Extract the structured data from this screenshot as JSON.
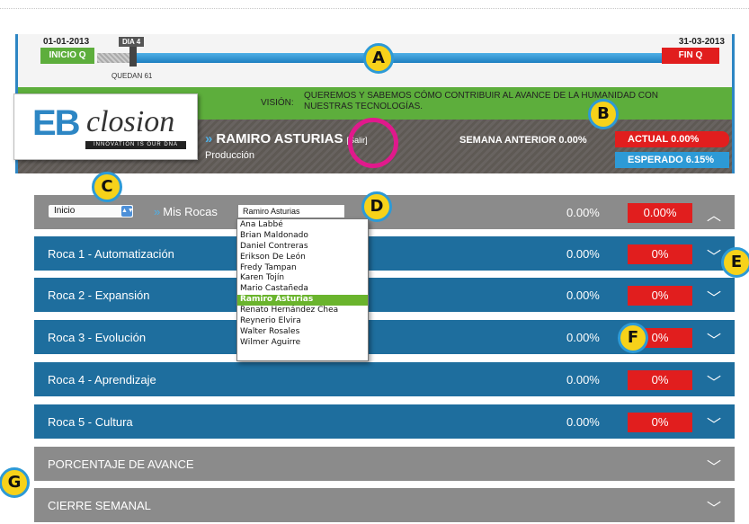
{
  "timeline": {
    "start_date": "01-01-2013",
    "day_tag": "DIA 4",
    "end_date": "31-03-2013",
    "start_label": "INICIO Q",
    "end_label": "FIN Q",
    "remaining": "QUEDAN 61",
    "progress_fraction": 0.045
  },
  "header": {
    "vision_label": "VISIÓN:",
    "vision_text": "QUEREMOS Y SABEMOS CÓMO CONTRIBUIR AL AVANCE DE LA HUMANIDAD CON NUESTRAS TECNOLOGÍAS.",
    "logo_eb": "EB",
    "logo_closion": "closion",
    "logo_tagline": "INNOVATION IS OUR DNA",
    "user_name": "RAMIRO ASTURIAS",
    "logout_label": "[Salir]",
    "user_role": "Producción",
    "prev_week": "SEMANA ANTERIOR 0.00%",
    "actual": "ACTUAL 0.00%",
    "expected": "ESPERADO 6.15%"
  },
  "toolbar": {
    "view_select": "Inicio",
    "section_label": "Mis Rocas",
    "user_select": "Ramiro Asturias",
    "pct": "0.00%",
    "badge": "0.00%"
  },
  "user_options": [
    "Ana Labbé",
    "Brian Maldonado",
    "Daniel Contreras",
    "Erikson De León",
    "Fredy Tampan",
    "Karen Tojín",
    "Mario Castañeda",
    "Ramiro Asturias",
    "Renato Hernández Chea",
    "Reynerio Elvira",
    "Walter Rosales",
    "Wilmer Aguirre"
  ],
  "rows": [
    {
      "label": "Roca 1 - Automatización",
      "pct": "0.00%",
      "badge": "0%"
    },
    {
      "label": "Roca 2 - Expansión",
      "pct": "0.00%",
      "badge": "0%"
    },
    {
      "label": "Roca 3 - Evolución",
      "pct": "0.00%",
      "badge": "0%"
    },
    {
      "label": "Roca 4 - Aprendizaje",
      "pct": "0.00%",
      "badge": "0%"
    },
    {
      "label": "Roca 5 - Cultura",
      "pct": "0.00%",
      "badge": "0%"
    }
  ],
  "sections": [
    {
      "label": "PORCENTAJE DE AVANCE"
    },
    {
      "label": "CIERRE SEMANAL"
    }
  ],
  "callouts": [
    "A",
    "B",
    "C",
    "D",
    "E",
    "F",
    "G"
  ],
  "colors": {
    "brand_blue": "#2d86c4",
    "green": "#5dae3c",
    "red": "#e11e1e",
    "row_blue": "#1e6e9e",
    "row_gray": "#8b8b8b",
    "callout_yellow": "#f7d21a",
    "highlight_ring": "#e0198c"
  }
}
